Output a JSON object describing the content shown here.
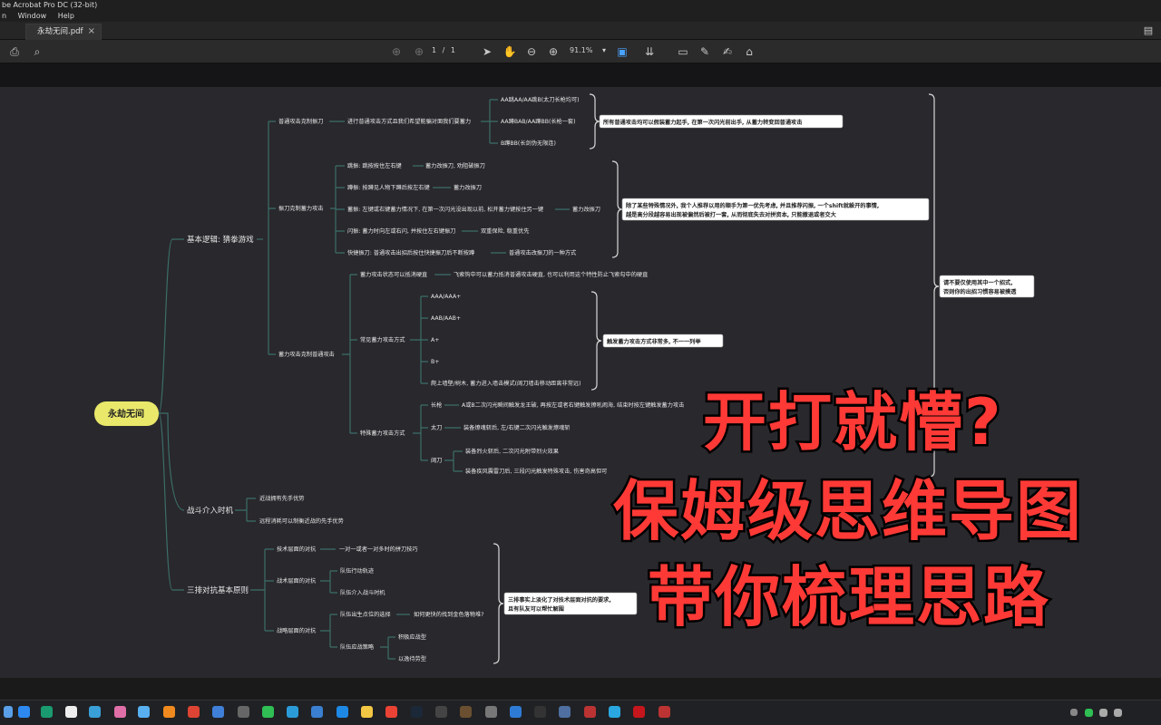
{
  "window": {
    "title": "be Acrobat Pro DC (32-bit)",
    "menu": [
      "n",
      "Window",
      "Help"
    ],
    "tab_title": "永劫无间.pdf"
  },
  "toolbar": {
    "page_current": "1",
    "page_sep": "/",
    "page_total": "1",
    "zoom": "91.1%",
    "icons": [
      "print-icon",
      "search-icon",
      "page-up-icon",
      "page-down-icon",
      "select-cursor-icon",
      "hand-tool-icon",
      "zoom-out-icon",
      "zoom-in-icon",
      "fit-page-icon",
      "scroll-mode-icon",
      "comment-icon",
      "highlight-icon",
      "draw-icon",
      "stamp-icon",
      "chat-icon"
    ]
  },
  "colors": {
    "canvas": "#29282d",
    "branch_line": "#3b6e68",
    "root_fill": "#e9e86a",
    "node_text": "#e8e8e8",
    "overlay_text": "#ff3a36"
  },
  "mindmap": {
    "root": "永劫无间",
    "b1": "基本逻辑: 猜拳游戏",
    "b1_1": "普通攻击克制振刀",
    "b1_1a": "进行普通攻击方式且我们希望能骗对面我们要蓄力",
    "b1_1a1": "AA跳AA/AA跳B(太刀长枪均可)",
    "b1_1a2": "AA蹲BAB/AA蹲BB(长枪一套)",
    "b1_1a3": "B蹲BB(长剑伪无限连)",
    "note1": "所有普通攻击均可以假装蓄力起手, 在第一次闪光前出手, 从蓄力转变回普通攻击",
    "b1_2": "振刀克制蓄力攻击",
    "b1_2a": "跳振: 跳按按住左右键",
    "b1_2a1": "蓄力改振刀, 劝阻破振刀",
    "b1_2b": "蹲振: 按蹲见人物下蹲后按左右键",
    "b1_2b1": "蓄力改振刀",
    "b1_2c": "蓄振: 左键或右键蓄力情况下, 在第一次闪光没出现以前, 松开蓄力键按住另一键",
    "b1_2c1": "蓄力改振刀",
    "b1_2d": "闪振: 蓄力时向左或右闪, 并按住左右键振刀",
    "b1_2d1": "双重保险, 稳重优先",
    "b1_2e": "快捷振刀: 普通攻击出招后按住快捷振刀后不断按蹲",
    "b1_2e1": "普通攻击改振刀的一种方式",
    "note2a": "除了某些特殊情况外, 我个人推荐以用的顺手为第一优先考虑, 并且推荐闪振, 一个shift就躲开的事情,",
    "note2b": "越是高分段越容易出现被偏然后被打一套, 从而彻底失去对拼资本, 只能撤退或者交大",
    "b1_3": "蓄力攻击克制普通攻击",
    "b1_3a": "蓄力攻击状态可以抵消硬直",
    "b1_3a1": "飞索钩中可以蓄力抵消普通攻击硬直, 也可以利用这个特性防止飞索勾中的硬直",
    "b1_3b": "常见蓄力攻击方式",
    "b1_3b_items": [
      "AAA/AAA+",
      "AAB/AAB+",
      "A+",
      "B+",
      "爬上墙壁/树木, 蓄力进入墙击模式(阔刀墙击移动距离非常远)"
    ],
    "note3": "触发蓄力攻击方式非常多, 不一一列举",
    "b1_3c": "特殊蓄力攻击方式",
    "b1_3c1": "长枪",
    "b1_3c1a": "A或B二次闪光瞬间触发龙王破, 再按左或者右键触发撩吼闹海, 结束时按左键触发蓄力攻击",
    "b1_3c2": "太刀",
    "b1_3c2a": "装备燎魂斩后, 左/右键二次闪光触发燎魂斩",
    "b1_3c3": "阔刀",
    "b1_3c3a": "装备烈火斩后, 二次闪光附带烈火效果",
    "b1_3c3b": "装备疾风震雷刀后, 三段闪光触发特殊攻击, 伤害奇高但可",
    "note4a": "请不要仅使用其中一个招式,",
    "note4b": "否则你的出招习惯容易被摸透",
    "b2": "战斗介入时机",
    "b2_1": "近战拥有先手优势",
    "b2_2": "远程消耗可以制衡近战的先手优势",
    "b3": "三排对抗基本原则",
    "b3_1": "技术层面的对抗",
    "b3_1a": "一对一或者一对多时的拼刀技巧",
    "b3_2": "战术层面的对抗",
    "b3_2a": "队伍行动轨迹",
    "b3_2b": "队伍介入战斗时机",
    "b3_3": "战略层面的对抗",
    "b3_3a": "队伍出生点位的选择",
    "b3_3a1": "如何更快的找到金色落物堆?",
    "b3_3b": "队伍应战策略",
    "b3_3b1": "积极应战型",
    "b3_3b2": "以逸待劳型",
    "note5a": "三排事实上淡化了对技术层面对抗的要求,",
    "note5b": "且有队友可以帮忙解围"
  },
  "overlay": {
    "line1": "开打就懵?",
    "line2": "保姆级思维导图",
    "line3": "带你梳理思路"
  }
}
